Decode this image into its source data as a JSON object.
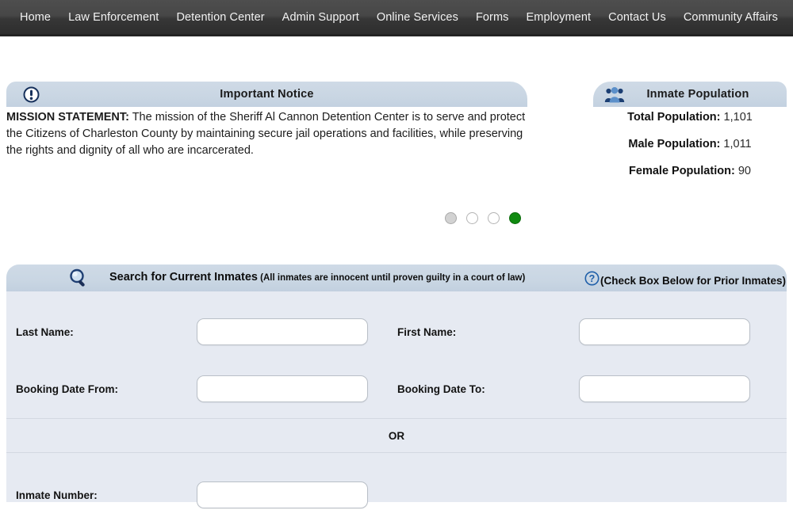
{
  "nav": {
    "items": [
      {
        "label": "Home"
      },
      {
        "label": "Law Enforcement"
      },
      {
        "label": "Detention Center"
      },
      {
        "label": "Admin Support"
      },
      {
        "label": "Online Services"
      },
      {
        "label": "Forms"
      },
      {
        "label": "Employment"
      },
      {
        "label": "Contact Us"
      },
      {
        "label": "Community Affairs"
      }
    ]
  },
  "notice": {
    "title": "Important Notice",
    "icon": "exclamation-circle-icon",
    "body_label": "MISSION STATEMENT:",
    "body_text": " The mission of the Sheriff Al Cannon Detention Center is to serve and protect the Citizens of Charleston County by maintaining secure jail operations and facilities, while preserving the rights and dignity of all who are incarcerated."
  },
  "population": {
    "title": "Inmate Population",
    "icon": "people-group-icon",
    "rows": [
      {
        "label": "Total Population:",
        "value": "1,101"
      },
      {
        "label": "Male Population:",
        "value": "1,011"
      },
      {
        "label": "Female Population:",
        "value": "90"
      }
    ]
  },
  "carousel": {
    "dots": [
      {
        "state": "grey"
      },
      {
        "state": "hollow"
      },
      {
        "state": "hollow"
      },
      {
        "state": "active"
      }
    ],
    "active_color": "#108a10"
  },
  "search": {
    "icon": "magnifier-icon",
    "title": "Search for Current Inmates",
    "title_paren": " (All inmates are innocent until proven guilty in a court of law)",
    "help_icon": "question-circle-icon",
    "note": "(Check Box Below for Prior Inmates)",
    "fields": {
      "last_name": {
        "label": "Last Name:",
        "value": "",
        "placeholder": ""
      },
      "first_name": {
        "label": "First Name:",
        "value": "",
        "placeholder": ""
      },
      "booking_date_from": {
        "label": "Booking Date From:",
        "value": "",
        "placeholder": ""
      },
      "booking_date_to": {
        "label": "Booking Date To:",
        "value": "",
        "placeholder": ""
      },
      "inmate_number": {
        "label": "Inmate Number:",
        "value": "",
        "placeholder": ""
      }
    },
    "or_text": "OR"
  },
  "colors": {
    "nav_top": "#4e4e4e",
    "nav_bottom": "#2d2d2d",
    "panel_header": "#cbd8e4",
    "form_body": "#e6eaf2",
    "accent_blue": "#1f5fa9"
  }
}
